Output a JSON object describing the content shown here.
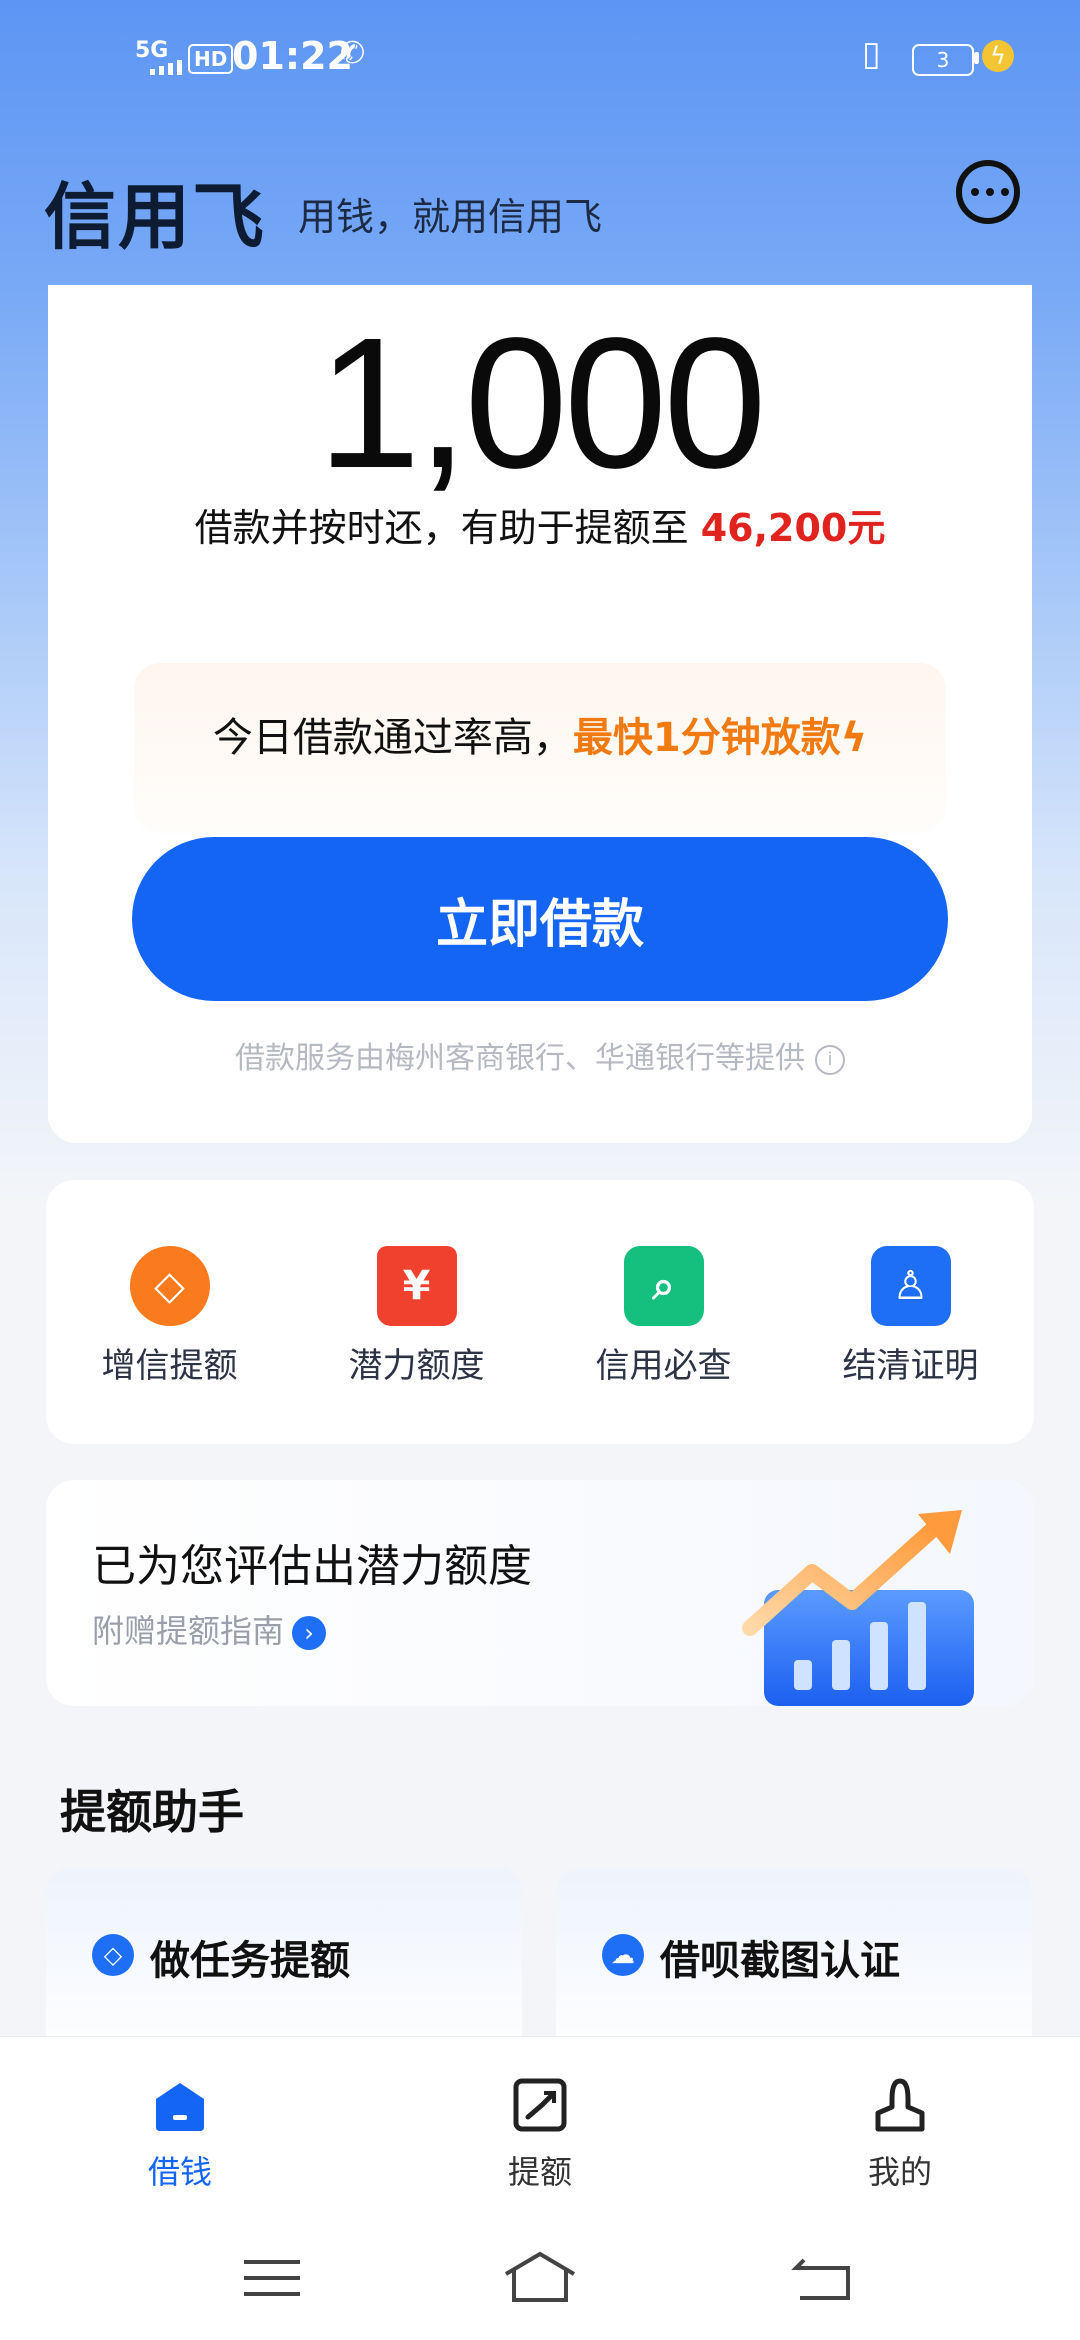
{
  "status_bar": {
    "network": "5G",
    "hd": "HD",
    "time": "01:22",
    "battery": "3"
  },
  "header": {
    "app_name": "信用飞",
    "slogan": "用钱，就用信用飞"
  },
  "loan_card": {
    "amount": "1,000",
    "hint_prefix": "借款并按时还，有助于提额至",
    "hint_amount": "46,200元",
    "promo_prefix": "今日借款通过率高，",
    "promo_highlight": "最快1分钟放款",
    "borrow_button": "立即借款",
    "provider_note": "借款服务由梅州客商银行、华通银行等提供"
  },
  "quick_actions": [
    {
      "label": "增信提额",
      "icon": "diamond-icon",
      "glyph": "◇"
    },
    {
      "label": "潜力额度",
      "icon": "yen-house-icon",
      "glyph": "¥"
    },
    {
      "label": "信用必查",
      "icon": "search-icon",
      "glyph": "⌕"
    },
    {
      "label": "结清证明",
      "icon": "stamp-icon",
      "glyph": "♙"
    }
  ],
  "assessment": {
    "title": "已为您评估出潜力额度",
    "subtitle": "附赠提额指南"
  },
  "assistant": {
    "title": "提额助手",
    "tasks": [
      {
        "label": "做任务提额",
        "icon": "diamond-icon"
      },
      {
        "label": "借呗截图认证",
        "icon": "cloud-icon"
      }
    ]
  },
  "bottom_nav": [
    {
      "label": "借钱",
      "icon": "home-icon",
      "active": true
    },
    {
      "label": "提额",
      "icon": "trend-box-icon",
      "active": false
    },
    {
      "label": "我的",
      "icon": "person-icon",
      "active": false
    }
  ],
  "colors": {
    "primary": "#1565f5",
    "accent_red": "#e0231f",
    "accent_orange": "#f27a12"
  }
}
